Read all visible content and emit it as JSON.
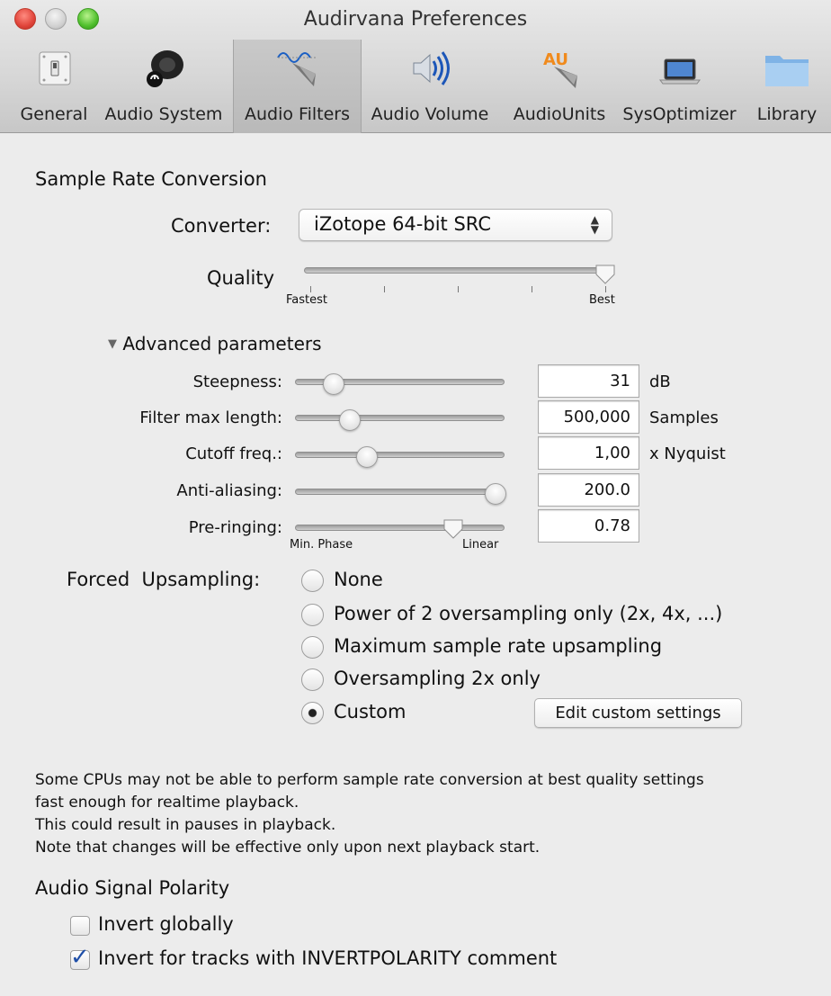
{
  "window": {
    "title": "Audirvana Preferences"
  },
  "toolbar": {
    "items": [
      {
        "label": "General",
        "icon": "switch-icon"
      },
      {
        "label": "Audio System",
        "icon": "speaker-icon"
      },
      {
        "label": "Audio Filters",
        "icon": "filter-wave-icon",
        "selected": true
      },
      {
        "label": "Audio Volume",
        "icon": "volume-icon"
      },
      {
        "label": "AudioUnits",
        "icon": "au-icon",
        "icon_text": "AU"
      },
      {
        "label": "SysOptimizer",
        "icon": "laptop-icon"
      },
      {
        "label": "Library",
        "icon": "folder-icon"
      }
    ]
  },
  "src": {
    "heading": "Sample Rate Conversion",
    "converter_label": "Converter:",
    "converter_value": "iZotope 64-bit SRC",
    "quality_label": "Quality",
    "quality_min": "Fastest",
    "quality_max": "Best",
    "quality_level": 1.0,
    "advanced_label": "Advanced parameters",
    "params": [
      {
        "label": "Steepness:",
        "value": "31",
        "unit": "dB",
        "level": 0.2
      },
      {
        "label": "Filter max length:",
        "value": "500,000",
        "unit": "Samples",
        "level": 0.28
      },
      {
        "label": "Cutoff freq.:",
        "value": "1,00",
        "unit": "x Nyquist",
        "level": 0.36
      },
      {
        "label": "Anti-aliasing:",
        "value": "200.0",
        "unit": "",
        "level": 1.0
      },
      {
        "label": "Pre-ringing:",
        "value": "0.78",
        "unit": "",
        "level": 0.78
      }
    ],
    "prering_min": "Min. Phase",
    "prering_max": "Linear"
  },
  "upsampling": {
    "label": "Forced  Upsampling:",
    "options": [
      "None",
      "Power of 2 oversampling only (2x, 4x, ...)",
      "Maximum sample rate upsampling",
      "Oversampling 2x only",
      "Custom"
    ],
    "selected": "Custom",
    "edit_button": "Edit custom settings"
  },
  "notes": [
    "Some CPUs may not be able to perform sample rate conversion at best quality settings",
    "fast enough for realtime playback.",
    "This could result in pauses in playback.",
    "Note that changes will be effective only upon next playback start."
  ],
  "polarity": {
    "heading": "Audio Signal Polarity",
    "invert_globally": "Invert globally",
    "invert_globally_checked": false,
    "invert_tracks": "Invert for tracks with INVERTPOLARITY comment",
    "invert_tracks_checked": true
  },
  "colors": {
    "accent_check": "#1f4fa8",
    "close": "#e0443a",
    "zoom": "#4fbf2c"
  }
}
